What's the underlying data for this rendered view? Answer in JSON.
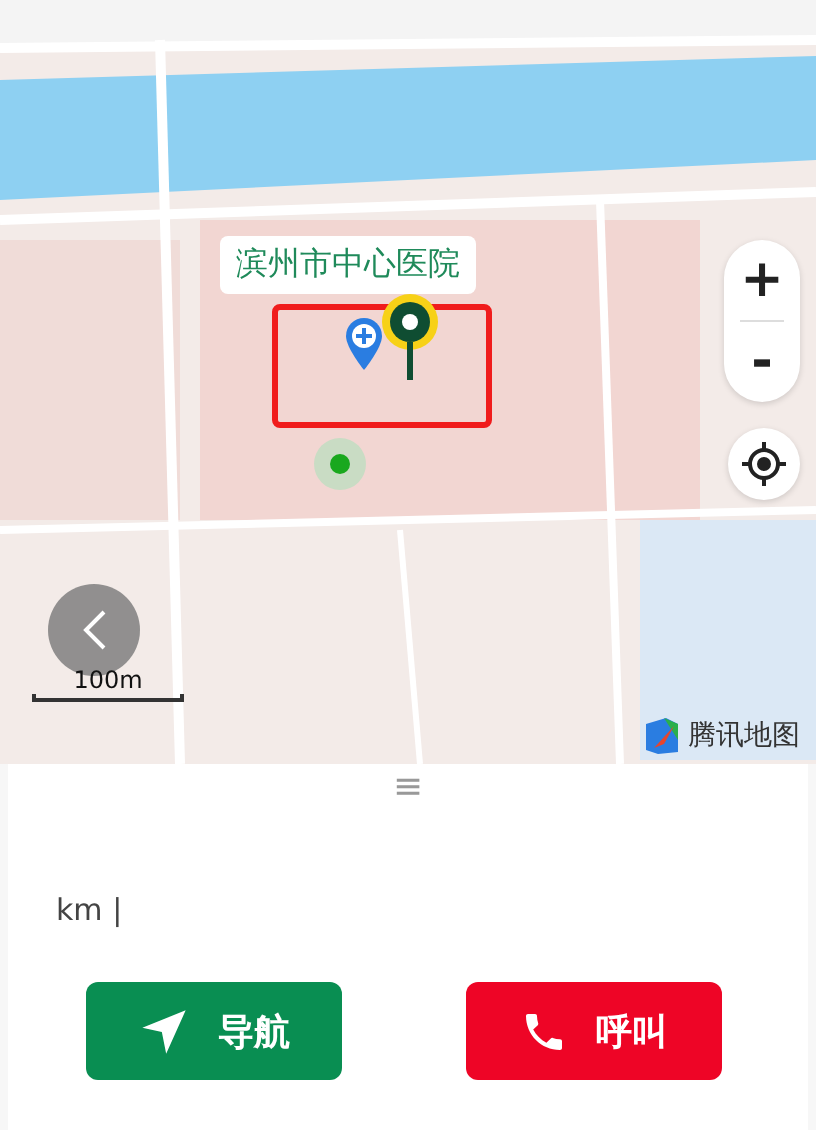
{
  "map": {
    "kind": "picture",
    "place_label": "滨州市中心医院",
    "zoom_in": "+",
    "zoom_out": "-",
    "scale": "100m",
    "provider": "腾讯地图",
    "highlighted": true
  },
  "panel": {
    "handle": "≡",
    "distance": "km |",
    "buttons": [
      {
        "kind": "navigate",
        "label": "导航"
      },
      {
        "kind": "call",
        "label": "呼叫"
      }
    ]
  }
}
